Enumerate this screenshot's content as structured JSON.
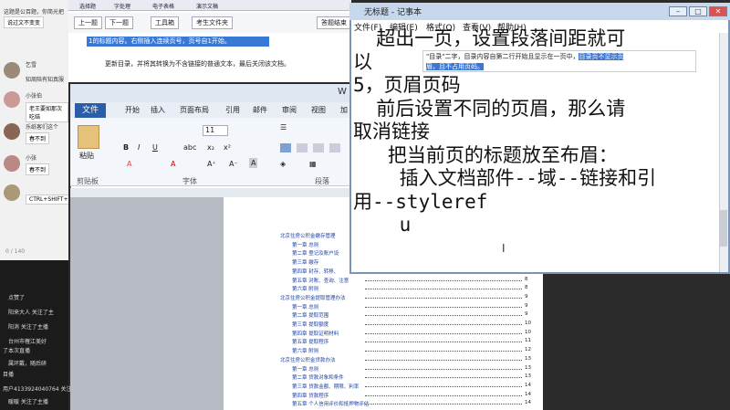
{
  "chat": {
    "messages": [
      "这题是公百题，你简光把",
      "说过文不变变",
      "乞雪",
      "知周陪有知真服",
      "小张伯",
      "老王要如那次吃结",
      "乐纸客们这个",
      "春不到",
      "小张",
      "春不到",
      "CTRL+SHIFT+L"
    ],
    "count": "0 / 140",
    "live": [
      {
        "badge": "",
        "text": "点赞了"
      },
      {
        "badge": "",
        "text": "阳来大人 关注了主"
      },
      {
        "badge": "",
        "text": "阳消 关注了主播"
      },
      {
        "badge": "",
        "text": "台州市榷江美好"
      },
      {
        "badge": "",
        "text": "了本次直播"
      },
      {
        "badge": "",
        "text": "属环戴，随后研"
      },
      {
        "badge": "",
        "text": "目播"
      },
      {
        "badge": "",
        "text": "用户4133924040764 关注了主"
      },
      {
        "badge": "",
        "text": "暖暖 关注了主播"
      }
    ]
  },
  "bgdoc": {
    "tabs": [
      "选择题",
      "字处理",
      "电子表格",
      "演示文稿"
    ],
    "toolbar": [
      "上一题",
      "下一题",
      "工具箱",
      "考生文件夹",
      "答题结束"
    ],
    "selected": "1的标题内容。右侧插入连续页号，页号自1开始。",
    "line7": "更新目录，并将其转换为不含链接的普通文本，最后关闭该文档。"
  },
  "word": {
    "title": "W",
    "tabs": [
      "文件",
      "开始",
      "插入",
      "页面布局",
      "引用",
      "邮件",
      "审阅",
      "视图",
      "加"
    ],
    "paste": "粘贴",
    "font_size": "11",
    "group_clipboard": "剪贴板",
    "group_font": "字体",
    "group_paragraph": "段落",
    "toc": [
      {
        "text": "北京住房公积金缴存管理",
        "page": "",
        "h": true
      },
      {
        "text": "第一章 总则",
        "page": "5"
      },
      {
        "text": "第二章 登记及账户设",
        "page": "5"
      },
      {
        "text": "第三章 缴存",
        "page": "6"
      },
      {
        "text": "第四章 封存、转移、",
        "page": "7"
      },
      {
        "text": "第五章 对账、查询、注意",
        "page": "8"
      },
      {
        "text": "第六章 附则",
        "page": "8"
      },
      {
        "text": "北京住房公积金提取管理办法",
        "page": "9",
        "h": true
      },
      {
        "text": "第一章 总则",
        "page": "9"
      },
      {
        "text": "第二章 提取范围",
        "page": "9"
      },
      {
        "text": "第三章 提取额度",
        "page": "10"
      },
      {
        "text": "第四章 提取证明材料",
        "page": "10"
      },
      {
        "text": "第五章 提取程序",
        "page": "11"
      },
      {
        "text": "第六章 附则",
        "page": "12"
      },
      {
        "text": "北京住房公积金贷款办法",
        "page": "13",
        "h": true
      },
      {
        "text": "第一章 总则",
        "page": "13"
      },
      {
        "text": "第二章 贷款对象和条件",
        "page": "13"
      },
      {
        "text": "第三章 贷款金额、期限、利率",
        "page": "14"
      },
      {
        "text": "第四章 贷款程序",
        "page": "14"
      },
      {
        "text": "第五章 个人信用评价和抵押物评估",
        "page": "14"
      }
    ]
  },
  "notepad": {
    "title": "无标题 - 记事本",
    "menu": [
      "文件(F)",
      "编辑(E)",
      "格式(O)",
      "查看(V)",
      "帮助(H)"
    ],
    "lines": [
      "  超出一页，设置段落间距就可",
      "以",
      "5，页眉页码",
      "  前后设置不同的页眉，那么请",
      "取消链接",
      "   把当前页的标题放至布眉：",
      "    插入文档部件--域--链接和引",
      "用--styleref",
      "    u"
    ],
    "popup_line1_prefix": "\"目录\"二字，目录内容自第二行开始且显示在一页中，",
    "popup_selected": "目录页不显示页",
    "popup_line2": "眉，且不占用页码。"
  }
}
